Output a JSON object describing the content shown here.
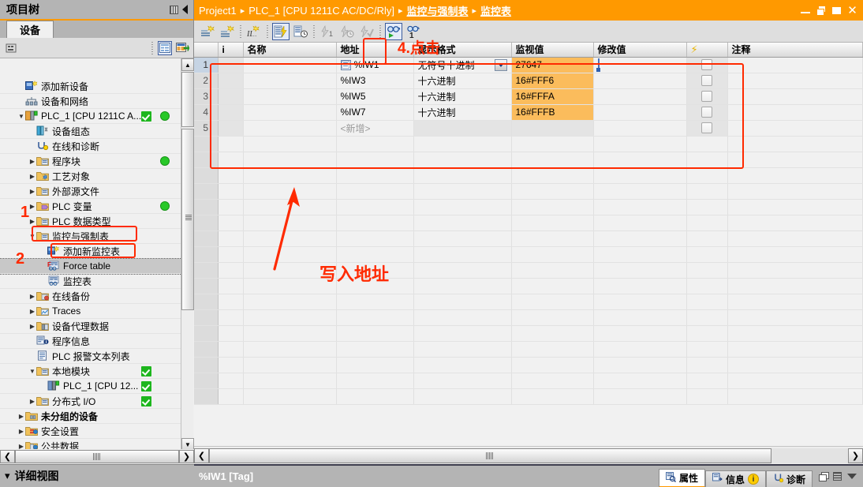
{
  "left_panel": {
    "title": "项目树",
    "tab": "设备",
    "detail_view": "详细视图",
    "tree": [
      {
        "label": "添加新设备",
        "indent": 1,
        "arrow": "",
        "icon": "add-device-icon",
        "chk": false,
        "dot": false,
        "sel": false,
        "bold": false
      },
      {
        "label": "设备和网络",
        "indent": 1,
        "arrow": "",
        "icon": "network-icon",
        "chk": false,
        "dot": false,
        "sel": false,
        "bold": false
      },
      {
        "label": "PLC_1 [CPU 1211C A...",
        "indent": 1,
        "arrow": "down",
        "icon": "plc-icon",
        "chk": true,
        "dot": true,
        "sel": false,
        "bold": false
      },
      {
        "label": "设备组态",
        "indent": 2,
        "arrow": "",
        "icon": "device-config-icon",
        "chk": false,
        "dot": false,
        "sel": false,
        "bold": false
      },
      {
        "label": "在线和诊断",
        "indent": 2,
        "arrow": "",
        "icon": "online-diag-icon",
        "chk": false,
        "dot": false,
        "sel": false,
        "bold": false
      },
      {
        "label": "程序块",
        "indent": 2,
        "arrow": "right",
        "icon": "folder-program-icon",
        "chk": false,
        "dot": true,
        "sel": false,
        "bold": false
      },
      {
        "label": "工艺对象",
        "indent": 2,
        "arrow": "right",
        "icon": "folder-tech-icon",
        "chk": false,
        "dot": false,
        "sel": false,
        "bold": false
      },
      {
        "label": "外部源文件",
        "indent": 2,
        "arrow": "right",
        "icon": "folder-source-icon",
        "chk": false,
        "dot": false,
        "sel": false,
        "bold": false
      },
      {
        "label": "PLC 变量",
        "indent": 2,
        "arrow": "right",
        "icon": "folder-tags-icon",
        "chk": false,
        "dot": true,
        "sel": false,
        "bold": false
      },
      {
        "label": "PLC 数据类型",
        "indent": 2,
        "arrow": "right",
        "icon": "folder-datatype-icon",
        "chk": false,
        "dot": false,
        "sel": false,
        "bold": false
      },
      {
        "label": "监控与强制表",
        "indent": 2,
        "arrow": "down",
        "icon": "folder-watch-icon",
        "chk": false,
        "dot": false,
        "sel": false,
        "bold": false
      },
      {
        "label": "添加新监控表",
        "indent": 3,
        "arrow": "",
        "icon": "add-watch-table-icon",
        "chk": false,
        "dot": false,
        "sel": false,
        "bold": false
      },
      {
        "label": "Force table",
        "indent": 3,
        "arrow": "",
        "icon": "force-table-icon",
        "chk": false,
        "dot": false,
        "sel": true,
        "bold": false
      },
      {
        "label": "监控表",
        "indent": 3,
        "arrow": "",
        "icon": "watch-table-icon",
        "chk": false,
        "dot": false,
        "sel": false,
        "bold": false
      },
      {
        "label": "在线备份",
        "indent": 2,
        "arrow": "right",
        "icon": "folder-backup-icon",
        "chk": false,
        "dot": false,
        "sel": false,
        "bold": false
      },
      {
        "label": "Traces",
        "indent": 2,
        "arrow": "right",
        "icon": "folder-traces-icon",
        "chk": false,
        "dot": false,
        "sel": false,
        "bold": false
      },
      {
        "label": "设备代理数据",
        "indent": 2,
        "arrow": "right",
        "icon": "folder-proxy-icon",
        "chk": false,
        "dot": false,
        "sel": false,
        "bold": false
      },
      {
        "label": "程序信息",
        "indent": 2,
        "arrow": "",
        "icon": "program-info-icon",
        "chk": false,
        "dot": false,
        "sel": false,
        "bold": false
      },
      {
        "label": "PLC 报警文本列表",
        "indent": 2,
        "arrow": "",
        "icon": "alarm-text-icon",
        "chk": false,
        "dot": false,
        "sel": false,
        "bold": false
      },
      {
        "label": "本地模块",
        "indent": 2,
        "arrow": "down",
        "icon": "folder-local-icon",
        "chk": true,
        "dot": false,
        "sel": false,
        "bold": false
      },
      {
        "label": "PLC_1 [CPU 12...",
        "indent": 3,
        "arrow": "",
        "icon": "plc-module-icon",
        "chk": true,
        "dot": false,
        "sel": false,
        "bold": false
      },
      {
        "label": "分布式 I/O",
        "indent": 2,
        "arrow": "right",
        "icon": "folder-distio-icon",
        "chk": true,
        "dot": false,
        "sel": false,
        "bold": false
      },
      {
        "label": "未分组的设备",
        "indent": 1,
        "arrow": "right",
        "icon": "ungrouped-icon",
        "chk": false,
        "dot": false,
        "sel": false,
        "bold": true
      },
      {
        "label": "安全设置",
        "indent": 1,
        "arrow": "right",
        "icon": "security-icon",
        "chk": false,
        "dot": false,
        "sel": false,
        "bold": false
      },
      {
        "label": "公共数据",
        "indent": 1,
        "arrow": "right",
        "icon": "common-data-icon",
        "chk": false,
        "dot": false,
        "sel": false,
        "bold": false
      }
    ]
  },
  "breadcrumb": {
    "items": [
      {
        "text": "Project1",
        "underline": false
      },
      {
        "text": "PLC_1 [CPU 1211C AC/DC/Rly]",
        "underline": false
      },
      {
        "text": "监控与强制表",
        "underline": true
      },
      {
        "text": "监控表",
        "underline": true
      }
    ],
    "separator": "▸"
  },
  "toolbar": {
    "icons": [
      "insert-row-icon",
      "insert-row-after-icon",
      "insert-line-icon",
      "monitor-all-icon",
      "monitor-once-icon",
      "modify-now-icon",
      "modify-with-trigger-icon",
      "enable-peripheral-icon",
      "monitor-start-icon",
      "monitor-once2-icon"
    ]
  },
  "table": {
    "headers": {
      "num": "",
      "i": "i",
      "name": "名称",
      "address": "地址",
      "format": "显示格式",
      "monitor": "监视值",
      "modify": "修改值",
      "bolt": "⚡",
      "comment": "注释"
    },
    "rows": [
      {
        "num": "1",
        "name": "",
        "address": "%IW1",
        "format": "无符号十进制",
        "monitor": "27647",
        "modify": "",
        "has_dropdown": true,
        "has_input": true,
        "addr_icon": true
      },
      {
        "num": "2",
        "name": "",
        "address": "%IW3",
        "format": "十六进制",
        "monitor": "16#FFF6",
        "modify": "",
        "has_dropdown": false,
        "has_input": false,
        "addr_icon": false
      },
      {
        "num": "3",
        "name": "",
        "address": "%IW5",
        "format": "十六进制",
        "monitor": "16#FFFA",
        "modify": "",
        "has_dropdown": false,
        "has_input": false,
        "addr_icon": false
      },
      {
        "num": "4",
        "name": "",
        "address": "%IW7",
        "format": "十六进制",
        "monitor": "16#FFFB",
        "modify": "",
        "has_dropdown": false,
        "has_input": false,
        "addr_icon": false
      },
      {
        "num": "5",
        "name": "",
        "address": "<新增>",
        "format": "",
        "monitor": "",
        "modify": "",
        "has_dropdown": false,
        "has_input": false,
        "addr_icon": false,
        "is_new": true
      }
    ]
  },
  "status_bar": {
    "label": "%IW1 [Tag]",
    "tabs": [
      {
        "label": "属性",
        "icon": "properties-icon",
        "active": true,
        "badge": ""
      },
      {
        "label": "信息",
        "icon": "info-icon",
        "active": false,
        "badge": "i"
      },
      {
        "label": "诊断",
        "icon": "diagnostics-icon",
        "active": false,
        "badge": ""
      }
    ]
  },
  "annotations": {
    "step1": "1",
    "step2": "2",
    "step4": "4.点击",
    "arrow_note": "写入地址"
  },
  "colors": {
    "accent_orange": "#ff9900",
    "annotation_red": "#ff2a00",
    "monitor_value_bg": "#fbbc5c",
    "status_green": "#28c828"
  }
}
